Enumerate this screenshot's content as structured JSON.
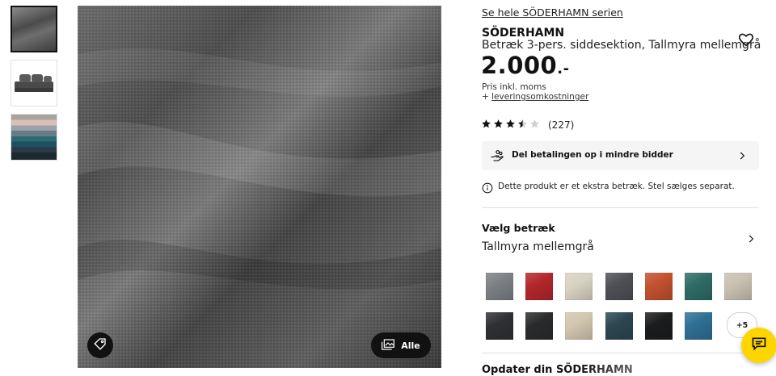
{
  "gallery": {
    "thumbnails": [
      {
        "name": "fabric-closeup-thumbnail"
      },
      {
        "name": "sofa-section-thumbnail"
      },
      {
        "name": "color-swatches-thumbnail"
      }
    ],
    "main_image": {
      "icon_left": "tag-icon",
      "all_label": "Alle",
      "all_icon": "gallery-icon"
    }
  },
  "product": {
    "series_link": "Se hele SÖDERHAMN serien",
    "name": "SÖDERHAMN",
    "description": "Betræk 3-pers. siddesektion, Tallmyra mellemgrå",
    "price_main": "2.000",
    "price_suffix": ".-",
    "price_note": "Pris inkl. moms",
    "shipping_prefix": "+ ",
    "shipping_link": "leveringsomkostninger",
    "favorite_icon": "heart-icon"
  },
  "rating": {
    "stars": 3.5,
    "max": 5,
    "count": "(227)"
  },
  "payment": {
    "label": "Del betalingen op i mindre bidder",
    "icon": "hand-coins-icon"
  },
  "info": {
    "text": "Dette produkt er et ekstra betræk. Stel sælges separat."
  },
  "cover": {
    "heading": "Vælg betræk",
    "selected": "Tallmyra mellemgrå",
    "swatches_row1": [
      "#7c7f84",
      "#b3262a",
      "#d9d2c4",
      "#4f5056",
      "#c2502e",
      "#2f6b66",
      "#c9c0b0"
    ],
    "swatches_row2": [
      "#2e3033",
      "#2a2b2c",
      "#d2c6ae",
      "#2c4750",
      "#1b1c1d",
      "#2f6f95"
    ],
    "more_label": "+5"
  },
  "update": {
    "title": "Opdater din SÖDERHAMN"
  },
  "chat": {
    "icon": "chat-icon"
  },
  "colors": {
    "accent_yellow": "#ffd500",
    "dark": "#111111"
  }
}
